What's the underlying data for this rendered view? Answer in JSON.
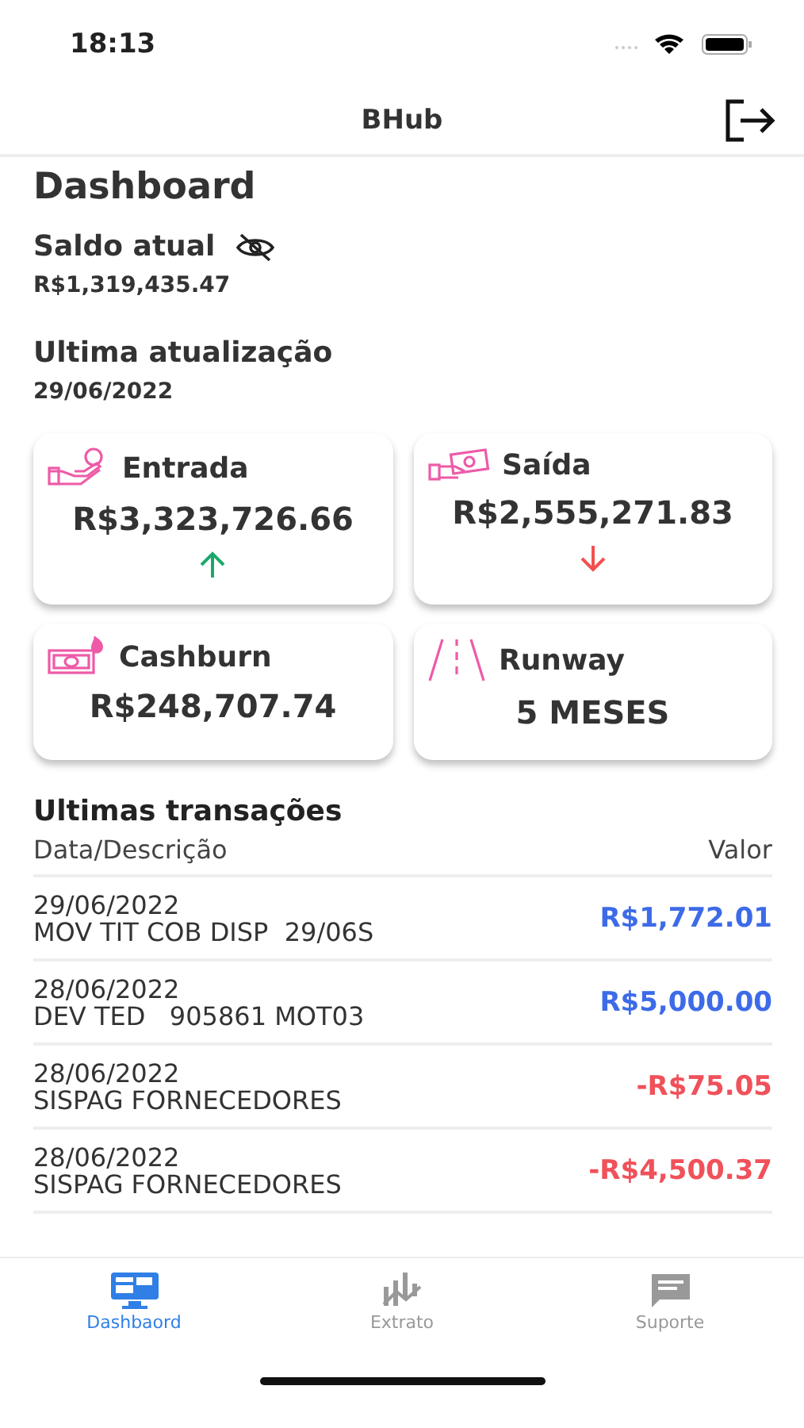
{
  "status_bar": {
    "time": "18:13"
  },
  "header": {
    "title": "BHub"
  },
  "page_title": "Dashboard",
  "balance": {
    "label": "Saldo atual",
    "value": "R$1,319,435.47"
  },
  "last_update": {
    "label": "Ultima atualização",
    "value": "29/06/2022"
  },
  "cards": [
    {
      "label": "Entrada",
      "value": "R$3,323,726.66",
      "kind": "up"
    },
    {
      "label": "Saída",
      "value": "R$2,555,271.83",
      "kind": "down"
    },
    {
      "label": "Cashburn",
      "value": "R$248,707.74",
      "kind": "plain"
    },
    {
      "label": "Runway",
      "value": "5 MESES",
      "kind": "plain"
    }
  ],
  "transactions": {
    "title": "Ultimas transações",
    "columns": [
      "Data/Descrição",
      "Valor"
    ],
    "rows": [
      {
        "date": "29/06/2022",
        "description": "MOV TIT COB DISP  29/06S",
        "amount": "R$1,772.01",
        "kind": "credit"
      },
      {
        "date": "28/06/2022",
        "description": "DEV TED   905861 MOT03",
        "amount": "R$5,000.00",
        "kind": "credit"
      },
      {
        "date": "28/06/2022",
        "description": "SISPAG FORNECEDORES",
        "amount": "-R$75.05",
        "kind": "debit"
      },
      {
        "date": "28/06/2022",
        "description": "SISPAG FORNECEDORES",
        "amount": "-R$4,500.37",
        "kind": "debit"
      }
    ]
  },
  "tabs": [
    {
      "label": "Dashbaord",
      "selected": true
    },
    {
      "label": "Extrato",
      "selected": false
    },
    {
      "label": "Suporte",
      "selected": false
    }
  ]
}
